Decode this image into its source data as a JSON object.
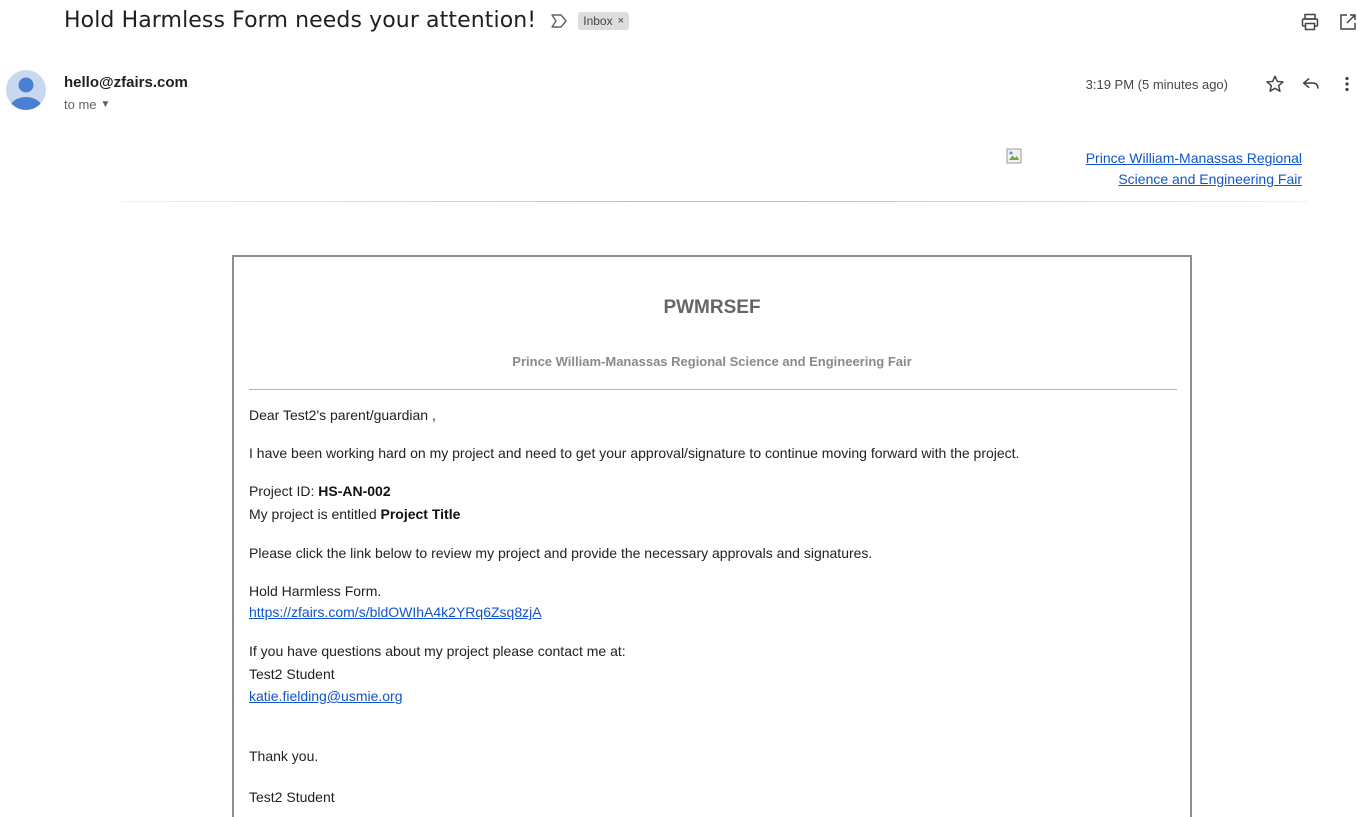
{
  "subject": {
    "title": "Hold Harmless Form needs your attention!",
    "label": "Inbox",
    "label_close": "×"
  },
  "sender": {
    "email": "hello@zfairs.com",
    "recipient": "to me",
    "timestamp": "3:19 PM (5 minutes ago)"
  },
  "icons": {
    "important": "important-marker-icon",
    "print": "print-icon",
    "open_new_window": "open-in-new-window-icon",
    "star": "star-icon",
    "reply": "reply-icon",
    "more": "more-vert-icon",
    "avatar": "avatar-person-icon",
    "broken_image": "broken-image-icon"
  },
  "header": {
    "fair_name_line1": "Prince William-Manassas Regional",
    "fair_name_line2": "Science and Engineering Fair"
  },
  "card": {
    "title": "PWMRSEF",
    "subtitle": "Prince William-Manassas Regional Science and Engineering Fair",
    "greeting": "Dear Test2's parent/guardian ,",
    "intro": "I have been working hard on my project and need to get your approval/signature to continue moving forward with the project.",
    "project_id_label": "Project ID: ",
    "project_id": "HS-AN-002",
    "project_title_label": "My project is entitled ",
    "project_title": "Project Title",
    "instructions": "Please click the link below to review my project and provide the necessary approvals and signatures.",
    "form_name": "Hold Harmless Form.",
    "form_link": "https://zfairs.com/s/bldOWIhA4k2YRq6Zsq8zjA",
    "contact_intro": "If you have questions about my project please contact me at:",
    "student_name": "Test2 Student",
    "student_email": "katie.fielding@usmie.org",
    "thanks": "Thank you.",
    "signature": "Test2 Student"
  },
  "colors": {
    "link": "#1155cc",
    "avatar_bg": "#c7d8f0",
    "avatar_fg": "#4a7fd4",
    "chip_bg": "#dddddd"
  }
}
